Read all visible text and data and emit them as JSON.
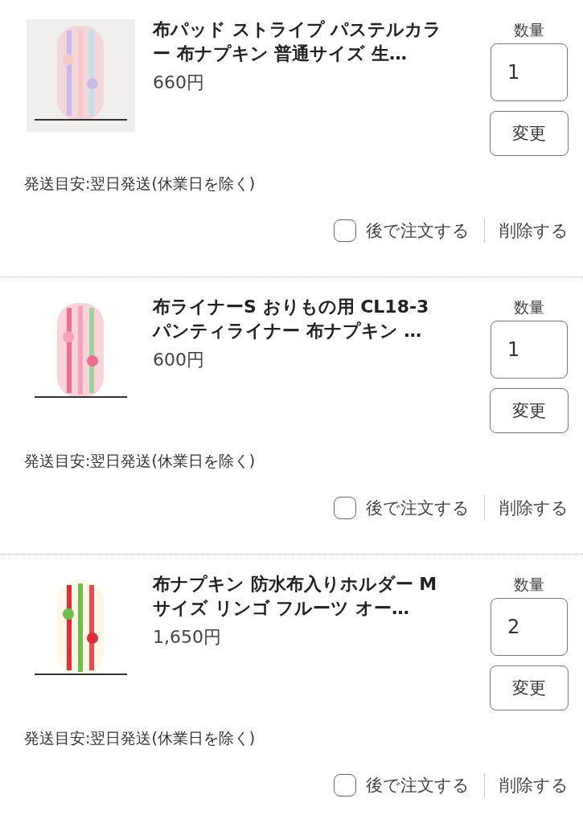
{
  "items": [
    {
      "title": "布パッド ストライプ パステルカラー 布ナプキン 普通サイズ 生…",
      "price": "660円",
      "quantity_label": "数量",
      "quantity": "1",
      "change_button": "変更",
      "shipping": "発送目安:翌日発送(休業日を除く)",
      "later": {
        "label": "後で注文する",
        "checked": false
      },
      "delete": "削除する"
    },
    {
      "title": "布ライナーS おりもの用 CL18-3 パンティライナー 布ナプキン …",
      "price": "600円",
      "quantity_label": "数量",
      "quantity": "1",
      "change_button": "変更",
      "shipping": "発送目安:翌日発送(休業日を除く)",
      "later": {
        "label": "後で注文する",
        "checked": false
      },
      "delete": "削除する"
    },
    {
      "title": "布ナプキン 防水布入りホルダー Mサイズ リンゴ フルーツ オー…",
      "price": "1,650円",
      "quantity_label": "数量",
      "quantity": "2",
      "change_button": "変更",
      "shipping": "発送目安:翌日発送(休業日を除く)",
      "later": {
        "label": "後で注文する",
        "checked": false
      },
      "delete": "削除する"
    }
  ]
}
